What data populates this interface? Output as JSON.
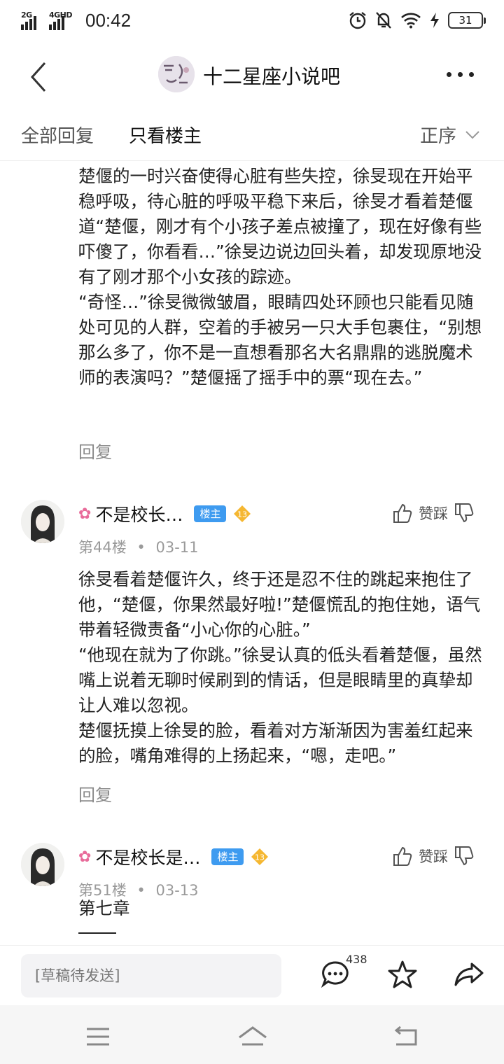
{
  "status_bar": {
    "net1": "2G",
    "net2": "4GHD",
    "time": "00:42",
    "battery": "31"
  },
  "header": {
    "forum_title": "十二星座小说吧"
  },
  "tabs": {
    "all_replies": "全部回复",
    "owner_only": "只看楼主",
    "sort": "正序"
  },
  "first_post": {
    "paragraphs": [
      "楚偃的一时兴奋使得心脏有些失控，徐旻现在开始平稳呼吸，待心脏的呼吸平稳下来后，徐旻才看着楚偃道“楚偃，刚才有个小孩子差点被撞了，现在好像有些吓傻了，你看看…”徐旻边说边回头着，却发现原地没有了刚才那个小女孩的踪迹。",
      "“奇怪…”徐旻微微皱眉，眼睛四处环顾也只能看见随处可见的人群，空着的手被另一只大手包裹住，“别想那么多了，你不是一直想看那名大名鼎鼎的逃脱魔术师的表演吗？”楚偃摇了摇手中的票“现在去。”"
    ],
    "reply": "回复"
  },
  "posts": [
    {
      "username": "不是校长…",
      "owner_badge": "楼主",
      "level": "13",
      "floor": "第44楼",
      "date": "03-11",
      "vote_label": "赞踩",
      "paragraphs": [
        "徐旻看着楚偃许久，终于还是忍不住的跳起来抱住了他，“楚偃，你果然最好啦!”楚偃慌乱的抱住她，语气带着轻微责备“小心你的心脏。”",
        "“他现在就为了你跳。”徐旻认真的低头看着楚偃，虽然嘴上说着无聊时候刷到的情话，但是眼睛里的真挚却让人难以忽视。",
        "楚偃抚摸上徐旻的脸，看着对方渐渐因为害羞红起来的脸，嘴角难得的上扬起来，“嗯，走吧。”"
      ],
      "reply": "回复"
    },
    {
      "username": "不是校长是…",
      "owner_badge": "楼主",
      "level": "13",
      "floor": "第51楼",
      "date": "03-13",
      "vote_label": "赞踩",
      "paragraphs": [
        "第七章"
      ]
    }
  ],
  "input_bar": {
    "placeholder": "[草稿待发送]",
    "reply_count": "438"
  },
  "icons": {
    "back": "back-arrow-icon",
    "more": "more-dots-icon",
    "like": "thumbs-up-icon",
    "dislike": "thumbs-down-icon",
    "comment": "comment-bubble-icon",
    "star": "star-icon",
    "share": "share-arrow-icon"
  },
  "colors": {
    "owner_badge": "#3e9bf0",
    "level_badge": "#f5b731",
    "muted_text": "#9a9a9a"
  }
}
